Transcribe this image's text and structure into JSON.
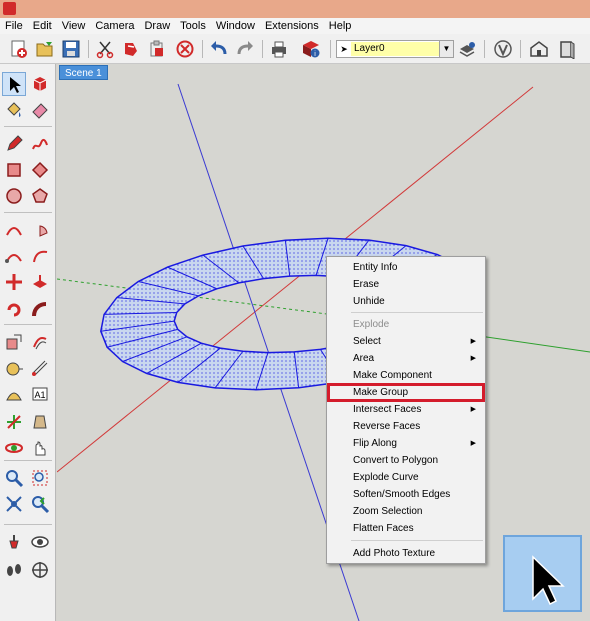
{
  "menubar": {
    "items": [
      "File",
      "Edit",
      "View",
      "Camera",
      "Draw",
      "Tools",
      "Window",
      "Extensions",
      "Help"
    ]
  },
  "toolbar": {
    "buttons": [
      "new-document-icon",
      "open-folder-icon",
      "save-icon",
      "cut-icon",
      "copy-icon",
      "paste-icon",
      "erase-icon",
      "undo-icon",
      "redo-icon",
      "print-icon",
      "model-info-icon",
      "select-arrow-icon",
      "layer-manager-icon",
      "vray-icon",
      "warehouse-icon",
      "extension-icon"
    ],
    "layer": {
      "current": "Layer0"
    }
  },
  "left_toolbar": {
    "tools": [
      "select-icon",
      "component-icon",
      "paint-bucket-icon",
      "eraser-icon",
      "pencil-icon",
      "freehand-icon",
      "rectangle-icon",
      "rotated-rectangle-icon",
      "circle-icon",
      "polygon-icon",
      "arc-icon",
      "pie-icon",
      "two-point-arc-icon",
      "three-point-arc-icon",
      "move-icon",
      "push-pull-icon",
      "rotate-icon",
      "follow-me-icon",
      "scale-icon",
      "offset-icon",
      "tape-measure-icon",
      "dimension-icon",
      "protractor-icon",
      "text-icon",
      "axes-icon",
      "section-plane-icon",
      "orbit-icon",
      "pan-icon",
      "zoom-icon",
      "zoom-window-icon",
      "zoom-extents-icon",
      "previous-view-icon",
      "position-camera-icon",
      "look-around-icon",
      "walk-icon",
      "section-icon"
    ]
  },
  "viewport": {
    "scene_tab": "Scene 1"
  },
  "context_menu": {
    "items": [
      {
        "label": "Entity Info",
        "disabled": false,
        "submenu": false
      },
      {
        "label": "Erase",
        "disabled": false,
        "submenu": false
      },
      {
        "label": "Unhide",
        "disabled": false,
        "submenu": false
      },
      {
        "label": "Explode",
        "disabled": true,
        "submenu": false
      },
      {
        "label": "Select",
        "disabled": false,
        "submenu": true
      },
      {
        "label": "Area",
        "disabled": false,
        "submenu": true
      },
      {
        "label": "Make Component",
        "disabled": false,
        "submenu": false
      },
      {
        "label": "Make Group",
        "disabled": false,
        "submenu": false,
        "highlighted": true
      },
      {
        "label": "Intersect Faces",
        "disabled": false,
        "submenu": true
      },
      {
        "label": "Reverse Faces",
        "disabled": false,
        "submenu": false
      },
      {
        "label": "Flip Along",
        "disabled": false,
        "submenu": true
      },
      {
        "label": "Convert to Polygon",
        "disabled": false,
        "submenu": false
      },
      {
        "label": "Explode Curve",
        "disabled": false,
        "submenu": false
      },
      {
        "label": "Soften/Smooth Edges",
        "disabled": false,
        "submenu": false
      },
      {
        "label": "Zoom Selection",
        "disabled": false,
        "submenu": false
      },
      {
        "label": "Flatten Faces",
        "disabled": false,
        "submenu": false
      },
      {
        "label": "Add Photo Texture",
        "disabled": false,
        "submenu": false
      }
    ]
  },
  "colors": {
    "selection": "#1a1ae0",
    "face_fill": "#c8d6ec",
    "axis_red": "#d23a3a",
    "axis_green": "#2ea02e",
    "axis_blue": "#3a3ad2",
    "highlight_box": "#d41c2c",
    "title_bar": "#e8a88a"
  }
}
